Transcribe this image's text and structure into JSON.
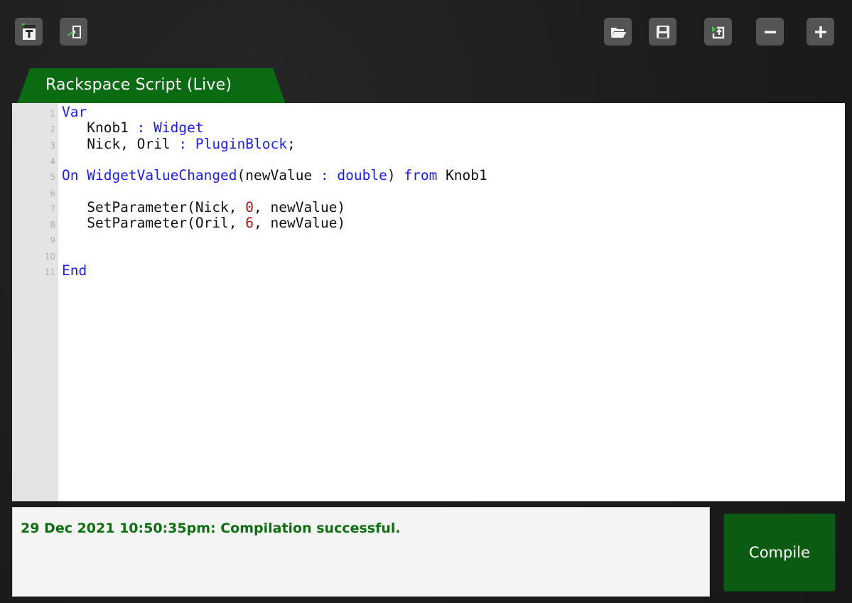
{
  "toolbar": {
    "left_buttons": [
      {
        "icon": "script-text-icon"
      },
      {
        "icon": "import-icon"
      }
    ],
    "right_buttons": [
      {
        "icon": "open-folder-icon"
      },
      {
        "icon": "save-icon"
      },
      {
        "icon": "export-icon"
      },
      {
        "icon": "minus-icon",
        "label": "−"
      },
      {
        "icon": "plus-icon",
        "label": "+"
      }
    ]
  },
  "tab": {
    "label": "Rackspace Script (Live)",
    "color": "#0a6b12"
  },
  "editor": {
    "lines": [
      {
        "n": "1",
        "segments": [
          {
            "t": "Var",
            "c": "kw"
          }
        ]
      },
      {
        "n": "2",
        "segments": [
          {
            "t": "   Knob1 ",
            "c": ""
          },
          {
            "t": ": Widget",
            "c": "kw"
          }
        ]
      },
      {
        "n": "3",
        "segments": [
          {
            "t": "   Nick, Oril ",
            "c": ""
          },
          {
            "t": ": PluginBlock",
            "c": "kw"
          },
          {
            "t": ";",
            "c": ""
          }
        ]
      },
      {
        "n": "4",
        "segments": []
      },
      {
        "n": "5",
        "segments": [
          {
            "t": "On WidgetValueChanged",
            "c": "kw"
          },
          {
            "t": "(newValue ",
            "c": ""
          },
          {
            "t": ": double",
            "c": "kw"
          },
          {
            "t": ") ",
            "c": ""
          },
          {
            "t": "from",
            "c": "kw"
          },
          {
            "t": " Knob1",
            "c": ""
          }
        ]
      },
      {
        "n": "6",
        "segments": []
      },
      {
        "n": "7",
        "segments": [
          {
            "t": "   SetParameter(Nick, ",
            "c": ""
          },
          {
            "t": "0",
            "c": "num"
          },
          {
            "t": ", newValue)",
            "c": ""
          }
        ]
      },
      {
        "n": "8",
        "segments": [
          {
            "t": "   SetParameter(Oril, ",
            "c": ""
          },
          {
            "t": "6",
            "c": "num"
          },
          {
            "t": ", newValue)",
            "c": ""
          }
        ]
      },
      {
        "n": "9",
        "segments": []
      },
      {
        "n": "10",
        "segments": []
      },
      {
        "n": "11",
        "segments": [
          {
            "t": "End",
            "c": "kw"
          }
        ]
      }
    ]
  },
  "status": {
    "message": "29 Dec 2021 10:50:35pm: Compilation successful."
  },
  "compile_button": {
    "label": "Compile"
  },
  "colors": {
    "keyword": "#1a1aff",
    "number": "#b01818",
    "success": "#0f6e12",
    "compile_bg": "#0b5b12"
  }
}
